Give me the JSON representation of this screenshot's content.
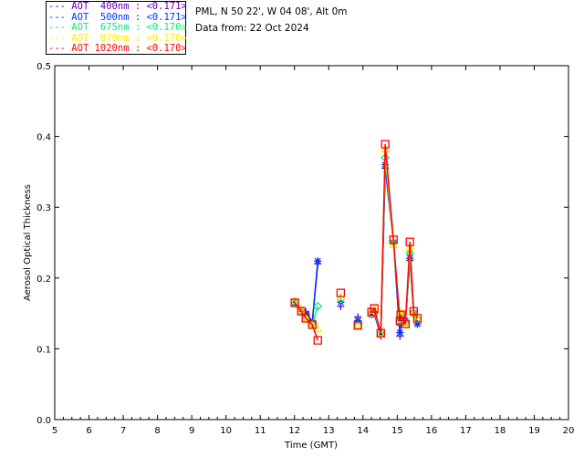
{
  "header": {
    "site": "PML, N 50 22', W 04 08', Alt 0m",
    "date_line": "Data from: 22 Oct 2024"
  },
  "chart_data": {
    "type": "line",
    "xlabel": "Time (GMT)",
    "ylabel": "Aerosol Optical Thickness",
    "xlim": [
      5,
      20
    ],
    "ylim": [
      0,
      0.5
    ],
    "xticks": [
      "5",
      "6",
      "7",
      "8",
      "9",
      "10",
      "11",
      "12",
      "13",
      "14",
      "15",
      "16",
      "17",
      "18",
      "19",
      "20"
    ],
    "yticks": [
      "0.0",
      "0.1",
      "0.2",
      "0.3",
      "0.4",
      "0.5"
    ],
    "legend_placement": "top-left",
    "x": [
      12.01,
      12.2,
      12.33,
      12.52,
      12.68,
      13.35,
      13.85,
      14.25,
      14.33,
      14.52,
      14.65,
      14.89,
      15.08,
      15.1,
      15.24,
      15.37,
      15.48,
      15.59
    ],
    "series": [
      {
        "name": "AOT  400nm : <0.171>",
        "color": "#6600aa",
        "marker": "plus",
        "values": [
          0.165,
          0.155,
          0.152,
          0.138,
          0.22,
          0.16,
          0.145,
          0.15,
          0.15,
          0.118,
          0.355,
          0.25,
          0.118,
          0.135,
          0.14,
          0.225,
          0.15,
          0.135
        ]
      },
      {
        "name": "AOT  500nm : <0.171>",
        "color": "#0033ff",
        "marker": "asterisk",
        "values": [
          0.165,
          0.155,
          0.15,
          0.137,
          0.224,
          0.166,
          0.14,
          0.148,
          0.15,
          0.12,
          0.36,
          0.25,
          0.123,
          0.14,
          0.14,
          0.228,
          0.15,
          0.135
        ]
      },
      {
        "name": "AOT  675nm : <0.170>",
        "color": "#00ee77",
        "marker": "diamond",
        "values": [
          0.165,
          0.153,
          0.143,
          0.135,
          0.16,
          0.17,
          0.133,
          0.15,
          0.153,
          0.122,
          0.37,
          0.25,
          0.14,
          0.148,
          0.137,
          0.235,
          0.15,
          0.142
        ]
      },
      {
        "name": "AOT  870nm : <0.170>",
        "color": "#ffee00",
        "marker": "triangle",
        "values": [
          0.168,
          0.155,
          0.143,
          0.133,
          0.128,
          0.173,
          0.133,
          0.15,
          0.155,
          0.122,
          0.382,
          0.247,
          0.142,
          0.152,
          0.136,
          0.243,
          0.15,
          0.142
        ]
      },
      {
        "name": "AOT 1020nm : <0.170>",
        "color": "#ff0000",
        "marker": "square",
        "values": [
          0.165,
          0.153,
          0.143,
          0.134,
          0.112,
          0.179,
          0.133,
          0.152,
          0.157,
          0.122,
          0.389,
          0.254,
          0.139,
          0.148,
          0.135,
          0.251,
          0.153,
          0.143
        ]
      }
    ]
  }
}
